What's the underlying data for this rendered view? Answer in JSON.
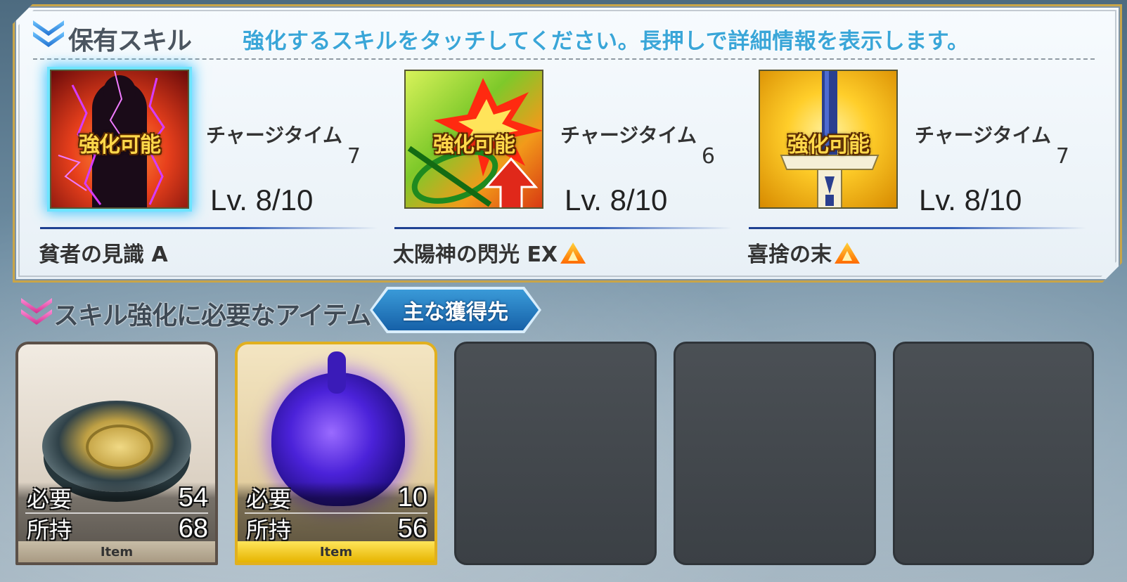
{
  "skills_panel": {
    "title": "保有スキル",
    "instruction": "強化するスキルをタッチしてください。長押しで詳細情報を表示します。",
    "skills": [
      {
        "name": "貧者の見識 A",
        "enhance_label": "強化可能",
        "charge_time_label": "チャージタイム",
        "charge_time": "7",
        "level": "Lv. 8/10",
        "upgrade_icon": false,
        "selected": true,
        "icon": "shadow-figure-lightning-icon"
      },
      {
        "name": "太陽神の閃光 EX",
        "enhance_label": "強化可能",
        "charge_time_label": "チャージタイム",
        "charge_time": "6",
        "level": "Lv. 8/10",
        "upgrade_icon": true,
        "selected": false,
        "icon": "burst-arrow-up-icon"
      },
      {
        "name": "喜捨の末",
        "enhance_label": "強化可能",
        "charge_time_label": "チャージタイム",
        "charge_time": "7",
        "level": "Lv. 8/10",
        "upgrade_icon": true,
        "selected": false,
        "icon": "sword-icon"
      }
    ]
  },
  "items_section": {
    "title": "スキル強化に必要なアイテム",
    "source_button": "主な獲得先",
    "items": [
      {
        "required_label": "必要",
        "required": "54",
        "owned_label": "所持",
        "owned": "68",
        "footer": "Item",
        "icon": "ancient-coin-icon",
        "rarity": "bronze"
      },
      {
        "required_label": "必要",
        "required": "10",
        "owned_label": "所持",
        "owned": "56",
        "footer": "Item",
        "icon": "purple-heart-icon",
        "rarity": "gold"
      }
    ],
    "empty_slots": 3
  },
  "colors": {
    "accent_blue": "#3aa6d8",
    "panel_border": "#c9a548",
    "enhance_text": "#ffd84a",
    "gold_frame": "#e1b01f"
  }
}
